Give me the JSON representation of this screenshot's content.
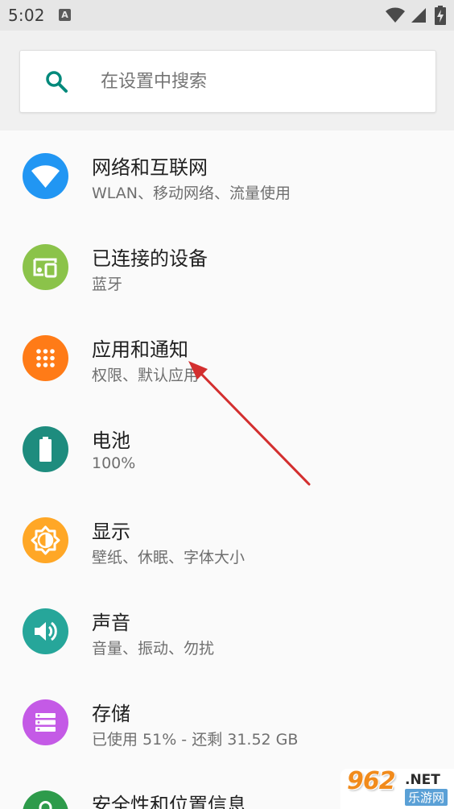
{
  "status_bar": {
    "time": "5:02",
    "notification_letter": "A",
    "icons": [
      "wifi-icon",
      "cellular-signal-icon",
      "battery-charging-icon"
    ]
  },
  "search": {
    "placeholder": "在设置中搜索",
    "icon": "search-icon",
    "accent_color": "#00897b"
  },
  "settings_items": [
    {
      "title": "网络和互联网",
      "subtitle": "WLAN、移动网络、流量使用",
      "icon": "wifi-icon",
      "color": "#2196f3"
    },
    {
      "title": "已连接的设备",
      "subtitle": "蓝牙",
      "icon": "connected-devices-icon",
      "color": "#8bc34a"
    },
    {
      "title": "应用和通知",
      "subtitle": "权限、默认应用",
      "icon": "apps-grid-icon",
      "color": "#ff7b17"
    },
    {
      "title": "电池",
      "subtitle": "100%",
      "icon": "battery-icon",
      "color": "#1e8c7e"
    },
    {
      "title": "显示",
      "subtitle": "壁纸、休眠、字体大小",
      "icon": "brightness-icon",
      "color": "#ffa726"
    },
    {
      "title": "声音",
      "subtitle": "音量、振动、勿扰",
      "icon": "volume-icon",
      "color": "#26a69a"
    },
    {
      "title": "存储",
      "subtitle": "已使用 51% - 还剩 31.52 GB",
      "icon": "storage-icon",
      "color": "#c45ae6"
    },
    {
      "title": "安全性和位置信息",
      "subtitle": "",
      "icon": "lock-icon",
      "color": "#2e9b4b"
    }
  ],
  "watermark": {
    "number": "962",
    "domain": ".NET",
    "site_name": "乐游网"
  },
  "annotation": {
    "arrow_color": "#d32f2f"
  }
}
